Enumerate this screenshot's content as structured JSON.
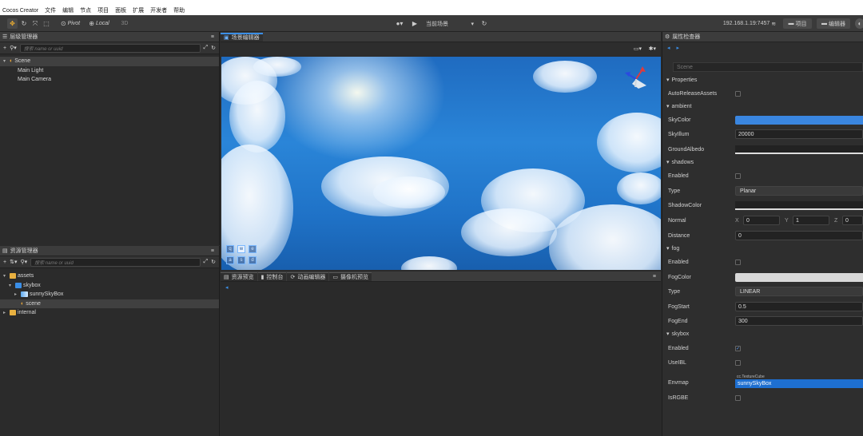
{
  "menubar": {
    "app_name": "Cocos Creator",
    "items": [
      "文件",
      "编辑",
      "节点",
      "项目",
      "面板",
      "扩展",
      "开发者",
      "帮助"
    ]
  },
  "toolbar": {
    "pivot_label": "Pivot",
    "local_label": "Local",
    "mode_3d_label": "3D",
    "scene_select_label": "当前场景",
    "ip_address": "192.168.1.19:7457",
    "project_label": "项目",
    "editor_label": "编辑器"
  },
  "hierarchy": {
    "title": "层级管理器",
    "search_placeholder": "搜索 name or uuid",
    "items": [
      {
        "label": "Scene",
        "depth": 0,
        "icon": "scene-icon"
      },
      {
        "label": "Main Light",
        "depth": 1,
        "icon": ""
      },
      {
        "label": "Main Camera",
        "depth": 1,
        "icon": ""
      }
    ]
  },
  "assets": {
    "title": "资源管理器",
    "search_placeholder": "搜索 name or uuid",
    "items": [
      {
        "label": "assets",
        "depth": 0,
        "icon": "db-icon"
      },
      {
        "label": "skybox",
        "depth": 1,
        "icon": "folder-icon"
      },
      {
        "label": "sunnySkyBox",
        "depth": 2,
        "icon": "texture-icon"
      },
      {
        "label": "scene",
        "depth": 2,
        "icon": "scene-icon"
      },
      {
        "label": "internal",
        "depth": 0,
        "icon": "db-icon"
      }
    ]
  },
  "scene_editor": {
    "tab_label": "场景编辑器",
    "keys": [
      "q",
      "w",
      "e",
      "a",
      "s",
      "d"
    ]
  },
  "bottom_tabs": [
    "资源预览",
    "控制台",
    "动画编辑器",
    "摄像机预览"
  ],
  "inspector": {
    "title": "属性检查器",
    "node_name": "Scene",
    "sections": [
      {
        "label": "Properties"
      },
      {
        "label": "ambient"
      },
      {
        "label": "shadows"
      },
      {
        "label": "fog"
      },
      {
        "label": "skybox"
      }
    ],
    "props": {
      "auto_release": "AutoReleaseAssets",
      "sky_color": "SkyColor",
      "sky_illum": "SkyIllum",
      "sky_illum_value": "20000",
      "ground_albedo": "GroundAlbedo",
      "shadows_enabled": "Enabled",
      "shadows_type": "Type",
      "shadows_type_value": "Planar",
      "shadow_color": "ShadowColor",
      "normal": "Normal",
      "normal_x_label": "X",
      "normal_x": "0",
      "normal_y_label": "Y",
      "normal_y": "1",
      "normal_z_label": "Z",
      "normal_z": "0",
      "distance": "Distance",
      "distance_value": "0",
      "fog_enabled": "Enabled",
      "fog_color": "FogColor",
      "fog_type": "Type",
      "fog_type_value": "LINEAR",
      "fog_start": "FogStart",
      "fog_start_value": "0.5",
      "fog_end": "FogEnd",
      "fog_end_value": "300",
      "skybox_enabled": "Enabled",
      "use_ibl": "UseIBL",
      "envmap": "Envmap",
      "envmap_type_hint": "cc.TextureCube",
      "envmap_value": "sunnySkyBox",
      "is_rgbe": "IsRGBE"
    }
  },
  "colors": {
    "accent": "#3a8ee6",
    "sky_color_swatch": "#3a86e0",
    "envmap_highlight": "#1e6fd0",
    "panel_bg": "#2b2b2b"
  }
}
